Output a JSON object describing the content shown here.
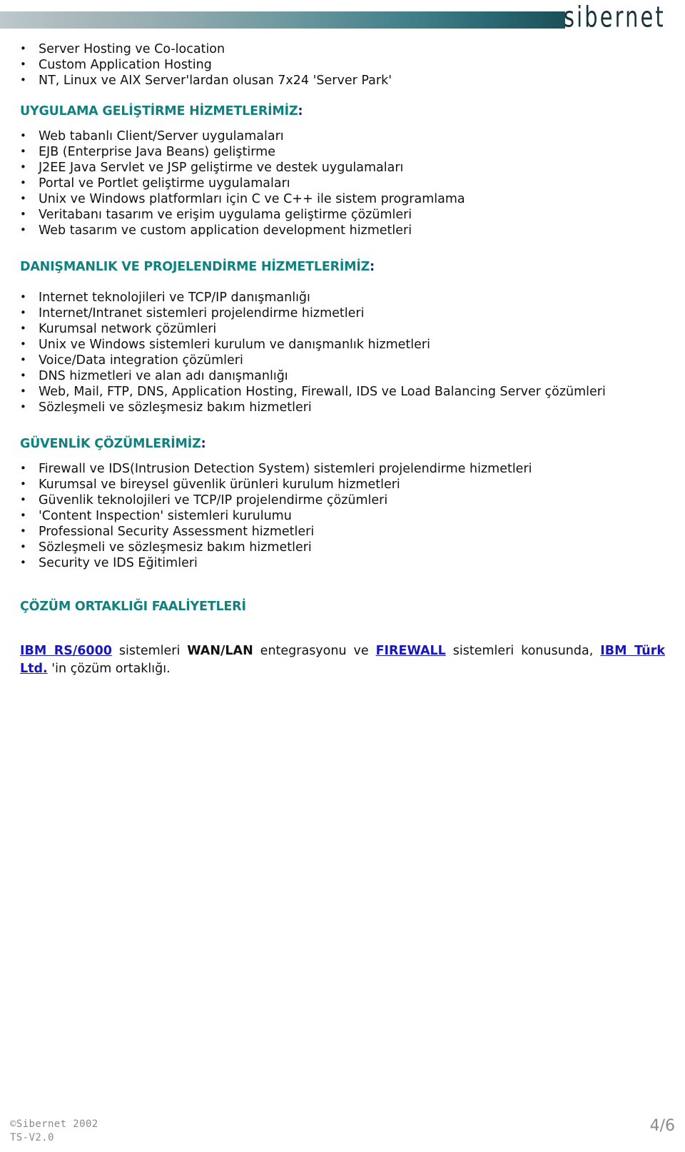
{
  "header": {
    "logo_text": "sibernet",
    "gradient_from": "#bcc8cb",
    "gradient_to": "#1d4f58"
  },
  "colors": {
    "heading_teal": "#11807e",
    "link_blue": "#1818b8",
    "body_text": "#111111",
    "footer_gray": "#8a8a8a"
  },
  "top_list": [
    "Server Hosting ve Co-location",
    "Custom Application Hosting",
    "NT, Linux ve AIX Server'lardan olusan 7x24 'Server Park'"
  ],
  "sections": [
    {
      "heading": "UYGULAMA GELİŞTİRME HİZMETLERİMİZ",
      "heading_colon": ":",
      "items": [
        "Web tabanlı Client/Server uygulamaları",
        "EJB (Enterprise Java Beans) geliştirme",
        "J2EE Java Servlet ve JSP geliştirme ve destek uygulamaları",
        "Portal ve Portlet geliştirme uygulamaları",
        "Unix ve Windows platformları için C ve C++ ile sistem programlama",
        "Veritabanı tasarım ve erişim uygulama geliştirme çözümleri",
        "Web tasarım ve custom application development hizmetleri"
      ]
    },
    {
      "heading": "DANIŞMANLIK VE PROJELENDİRME HİZMETLERİMİZ",
      "heading_colon": ":",
      "items": [
        "Internet teknolojileri ve TCP/IP danışmanlığı",
        "Internet/Intranet sistemleri projelendirme hizmetleri",
        "Kurumsal network çözümleri",
        "Unix ve Windows sistemleri kurulum ve danışmanlık hizmetleri",
        "Voice/Data integration çözümleri",
        "DNS hizmetleri ve alan adı danışmanlığı",
        "Web, Mail, FTP, DNS, Application Hosting, Firewall, IDS ve Load Balancing Server çözümleri",
        "Sözleşmeli ve sözleşmesiz bakım hizmetleri"
      ]
    },
    {
      "heading": "GÜVENLİK ÇÖZÜMLERİMİZ",
      "heading_colon": ":",
      "items": [
        "Firewall ve IDS(Intrusion Detection System) sistemleri projelendirme hizmetleri",
        "Kurumsal ve bireysel güvenlik ürünleri kurulum hizmetleri",
        "Güvenlik teknolojileri ve TCP/IP projelendirme çözümleri",
        "'Content Inspection' sistemleri kurulumu",
        "Professional Security Assessment hizmetleri",
        "Sözleşmeli ve sözleşmesiz bakım hizmetleri",
        "Security ve IDS Eğitimleri"
      ]
    }
  ],
  "partnership": {
    "heading": "ÇÖZÜM ORTAKLIĞI FAALİYETLERİ",
    "link1": "IBM RS/6000",
    "text1": " sistemleri ",
    "bold1": "WAN/LAN",
    "text2": " entegrasyonu ve ",
    "link2": "FIREWALL",
    "text3": " sistemleri konusunda, ",
    "link3": "IBM Türk Ltd.",
    "text4": " 'in çözüm ortaklığı."
  },
  "footer": {
    "copyright": "©Sibernet 2002",
    "version": "TS-V2.0",
    "page_number": "4/6"
  }
}
